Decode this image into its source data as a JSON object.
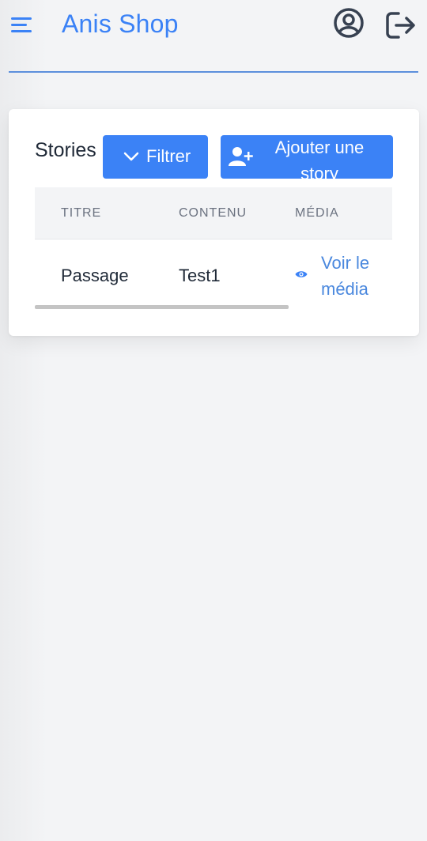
{
  "header": {
    "app_title": "Anis Shop",
    "menu_icon": "menu-icon",
    "profile_icon": "user-circle-icon",
    "logout_icon": "logout-icon"
  },
  "card": {
    "title": "Stories",
    "filter_button": {
      "label": "Filtrer",
      "icon": "chevron-down-icon"
    },
    "add_button": {
      "label": "Ajouter une story",
      "icon": "user-plus-icon"
    },
    "table": {
      "columns": [
        "TITRE",
        "CONTENU",
        "MÉDIA"
      ],
      "rows": [
        {
          "titre": "Passage",
          "contenu": "Test1",
          "media_link": "Voir le média"
        }
      ]
    }
  },
  "colors": {
    "accent": "#3b82f6",
    "link": "#4a88de",
    "text": "#1f2937",
    "header_row_bg": "#f3f4f6"
  }
}
